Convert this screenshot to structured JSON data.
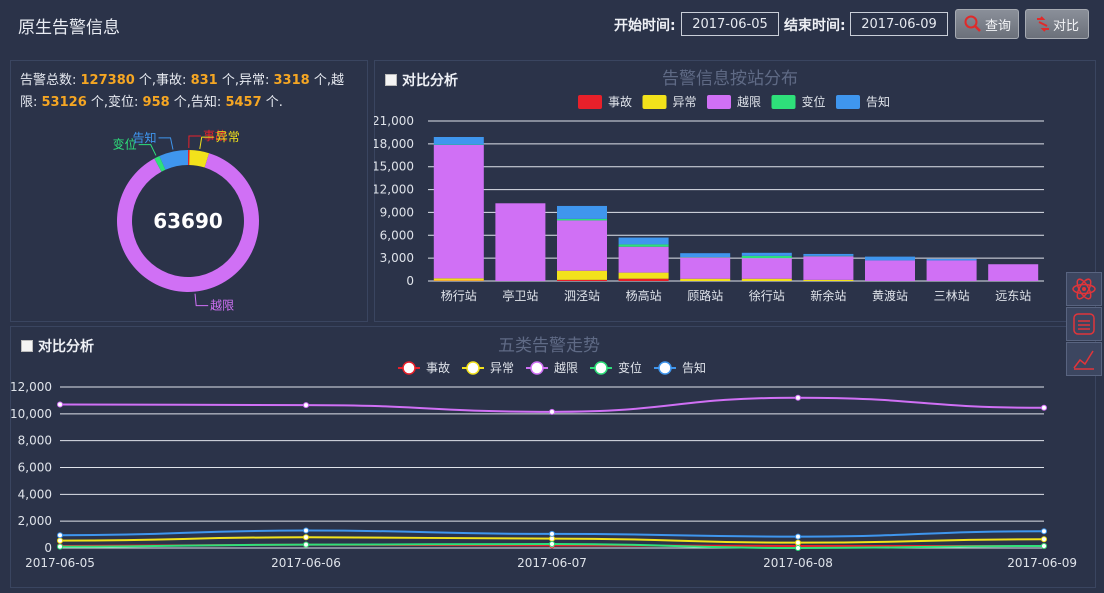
{
  "header": {
    "title": "原生告警信息",
    "start_label": "开始时间:",
    "start_value": "2017-06-05",
    "end_label": "结束时间:",
    "end_value": "2017-06-09",
    "query_label": "查询",
    "compare_label": "对比"
  },
  "summary": {
    "t1": "告警总数: ",
    "total": "127380",
    "t2": " 个,事故: ",
    "accident": "831",
    "t3": " 个,异常: ",
    "abnormal": "3318",
    "t4": " 个,越限: ",
    "overlimit": "53126",
    "t5": " 个,变位: ",
    "displacement": "958",
    "t6": " 个,告知: ",
    "notice": "5457",
    "t7": " 个."
  },
  "donut": {
    "center_value": "63690",
    "slices": [
      {
        "name": "事故",
        "value": 228,
        "color": "#e8202a"
      },
      {
        "name": "异常",
        "value": 2830,
        "color": "#f2e21b"
      },
      {
        "name": "越限",
        "value": 55620,
        "color": "#d070f5"
      },
      {
        "name": "变位",
        "value": 810,
        "color": "#2ee07a"
      },
      {
        "name": "告知",
        "value": 4202,
        "color": "#3f96ee"
      }
    ]
  },
  "bar_panel": {
    "compare_label": "对比分析",
    "title": "告警信息按站分布"
  },
  "line_panel": {
    "compare_label": "对比分析",
    "title": "五类告警走势"
  },
  "chart_data": [
    {
      "type": "bar",
      "title": "告警信息按站分布",
      "stacked": true,
      "categories": [
        "杨行站",
        "亭卫站",
        "泗泾站",
        "杨高站",
        "顾路站",
        "徐行站",
        "新余站",
        "黄渡站",
        "三林站",
        "远东站"
      ],
      "ylim": [
        0,
        21000
      ],
      "yticks": [
        "0",
        "3,000",
        "6,000",
        "9,000",
        "12,000",
        "15,000",
        "18,000",
        "21,000"
      ],
      "series": [
        {
          "name": "事故",
          "color": "#e8202a",
          "values": [
            50,
            0,
            150,
            300,
            0,
            0,
            0,
            0,
            0,
            0
          ]
        },
        {
          "name": "异常",
          "color": "#f2e21b",
          "values": [
            300,
            0,
            1200,
            800,
            300,
            300,
            150,
            0,
            0,
            0
          ]
        },
        {
          "name": "越限",
          "color": "#d070f5",
          "values": [
            17500,
            10200,
            6600,
            3400,
            2800,
            2700,
            3100,
            2700,
            2700,
            2200
          ]
        },
        {
          "name": "变位",
          "color": "#2ee07a",
          "values": [
            50,
            0,
            200,
            300,
            50,
            300,
            50,
            0,
            0,
            0
          ]
        },
        {
          "name": "告知",
          "color": "#3f96ee",
          "values": [
            1000,
            0,
            1700,
            900,
            500,
            400,
            250,
            500,
            200,
            0
          ]
        }
      ],
      "legend": "top-center"
    },
    {
      "type": "line",
      "title": "五类告警走势",
      "x": [
        "2017-06-05",
        "2017-06-06",
        "2017-06-07",
        "2017-06-08",
        "2017-06-09"
      ],
      "ylim": [
        0,
        12000
      ],
      "yticks": [
        "0",
        "2,000",
        "4,000",
        "6,000",
        "8,000",
        "10,000",
        "12,000"
      ],
      "series": [
        {
          "name": "事故",
          "color": "#e8202a",
          "values": [
            150,
            250,
            200,
            150,
            150
          ]
        },
        {
          "name": "异常",
          "color": "#f2e21b",
          "values": [
            550,
            800,
            700,
            400,
            650
          ]
        },
        {
          "name": "越限",
          "color": "#d070f5",
          "values": [
            10700,
            10650,
            10150,
            11200,
            10450
          ]
        },
        {
          "name": "变位",
          "color": "#2ee07a",
          "values": [
            100,
            250,
            300,
            0,
            150
          ]
        },
        {
          "name": "告知",
          "color": "#3f96ee",
          "values": [
            950,
            1300,
            1050,
            850,
            1250
          ]
        }
      ],
      "legend": "top-center"
    }
  ]
}
